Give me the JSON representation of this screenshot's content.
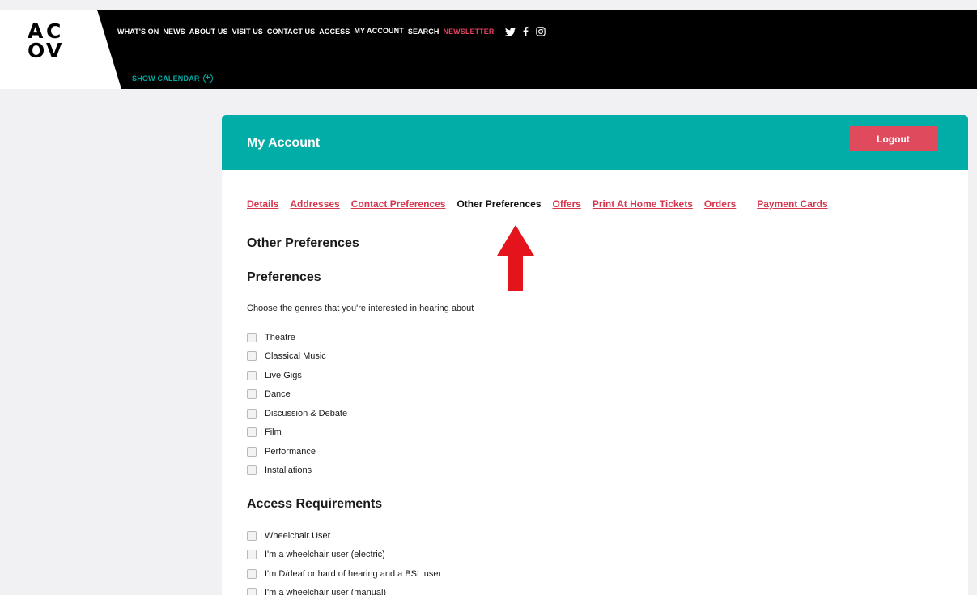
{
  "header": {
    "logo_letters": [
      "A",
      "C",
      "O",
      "V"
    ],
    "nav": [
      "WHAT'S ON",
      "NEWS",
      "ABOUT US",
      "VISIT US",
      "CONTACT US",
      "ACCESS",
      "MY ACCOUNT",
      "SEARCH",
      "NEWSLETTER"
    ],
    "show_calendar": "SHOW CALENDAR",
    "social_icons": [
      "twitter-icon",
      "facebook-icon",
      "instagram-icon"
    ]
  },
  "account": {
    "title": "My Account",
    "logout_label": "Logout",
    "tabs": [
      "Details",
      "Addresses",
      "Contact Preferences",
      "Other Preferences",
      "Offers",
      "Print At Home Tickets",
      "Orders",
      "Payment Cards"
    ],
    "selected_tab": "Other Preferences"
  },
  "other_preferences": {
    "heading": "Other Preferences",
    "preferences_heading": "Preferences",
    "intro": "Choose the genres that you're interested in hearing about",
    "genres": [
      "Theatre",
      "Classical Music",
      "Live Gigs",
      "Dance",
      "Discussion & Debate",
      "Film",
      "Performance",
      "Installations"
    ],
    "access_heading": "Access Requirements",
    "access_items": [
      "Wheelchair User",
      "I'm a wheelchair user (electric)",
      "I'm D/deaf or hard of hearing and a BSL user",
      "I'm a wheelchair user (manual)"
    ]
  },
  "colors": {
    "teal": "#00ada7",
    "red": "#df4a5d",
    "link_red": "#d4374f",
    "annotation_arrow": "#e4141c"
  }
}
